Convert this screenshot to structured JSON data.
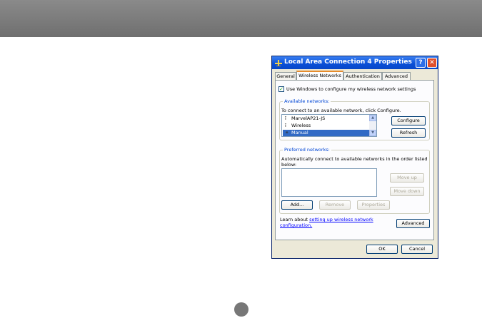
{
  "dialog": {
    "title": "Local Area Connection 4 Properties",
    "help_glyph": "?",
    "close_glyph": "✕",
    "tabs": [
      {
        "label": "General"
      },
      {
        "label": "Wireless Networks"
      },
      {
        "label": "Authentication"
      },
      {
        "label": "Advanced"
      }
    ],
    "use_windows_label": "Use Windows to configure my wireless network settings",
    "available": {
      "title": "Available networks:",
      "instruction": "To connect to an available network, click Configure.",
      "networks": [
        {
          "name": "MarvelAP21-JS"
        },
        {
          "name": "Wireless"
        },
        {
          "name": "Manual"
        }
      ],
      "configure_label": "Configure",
      "refresh_label": "Refresh"
    },
    "preferred": {
      "title": "Preferred networks:",
      "instruction_line1": "Automatically connect to available networks in the order listed",
      "instruction_line2": "below:",
      "move_up_label": "Move up",
      "move_down_label": "Move down",
      "add_label": "Add...",
      "remove_label": "Remove",
      "properties_label": "Properties"
    },
    "learn_prefix": "Learn about ",
    "learn_link_line1": "setting up wireless network",
    "learn_link_line2": "configuration.",
    "advanced_label": "Advanced",
    "ok_label": "OK",
    "cancel_label": "Cancel"
  },
  "colors": {
    "titlebar": "#0a4fd6",
    "selection": "#316ac5",
    "group_title": "#0046d5",
    "link": "#0000ff"
  }
}
